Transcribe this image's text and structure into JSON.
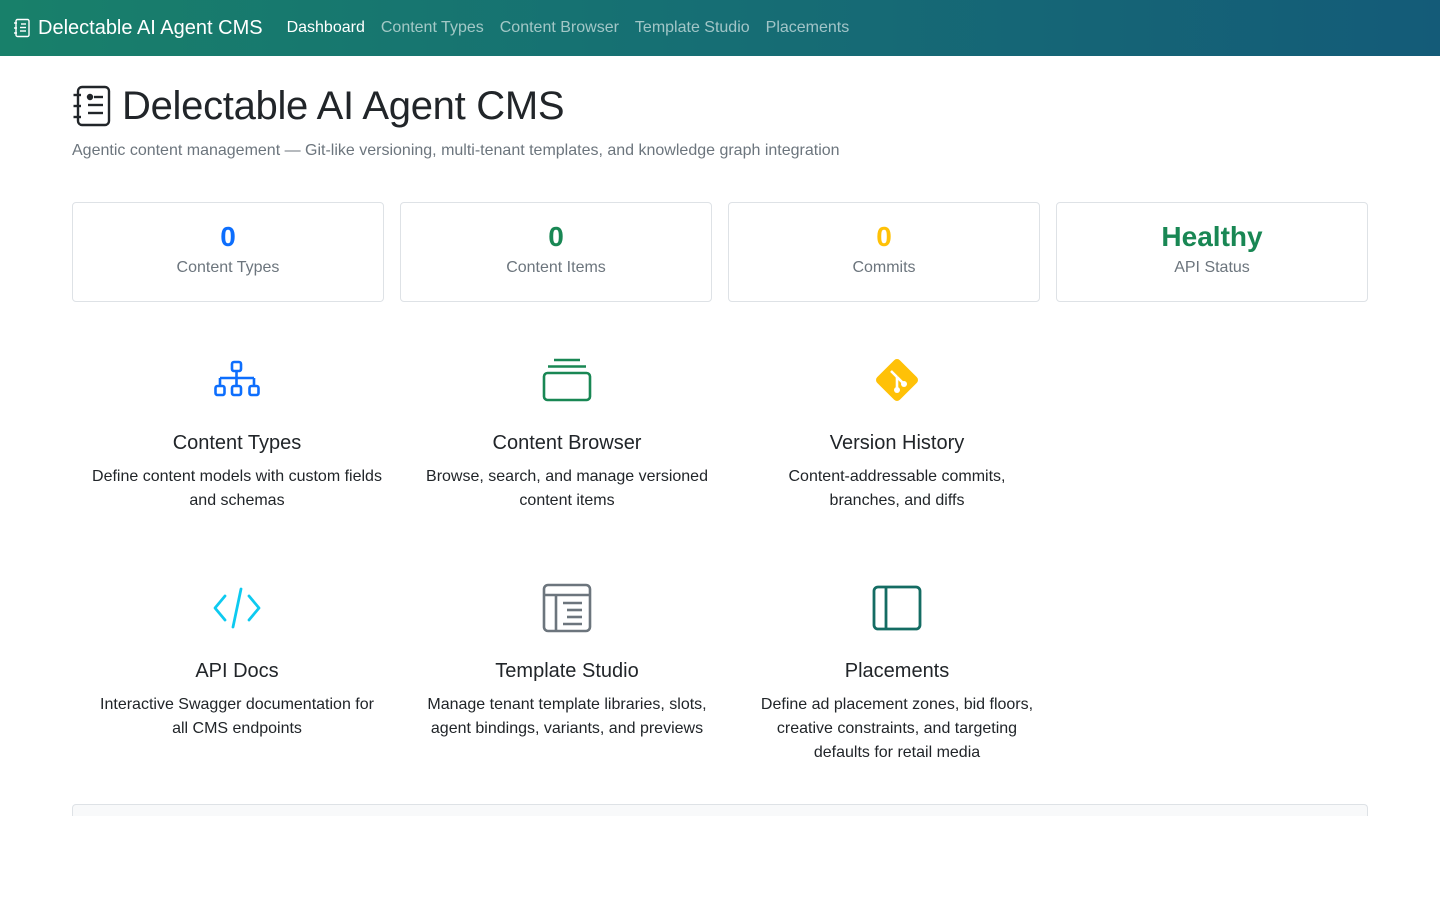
{
  "nav": {
    "brand": "Delectable AI Agent CMS",
    "links": [
      {
        "label": "Dashboard",
        "active": true
      },
      {
        "label": "Content Types",
        "active": false
      },
      {
        "label": "Content Browser",
        "active": false
      },
      {
        "label": "Template Studio",
        "active": false
      },
      {
        "label": "Placements",
        "active": false
      }
    ]
  },
  "header": {
    "title": "Delectable AI Agent CMS",
    "subtitle": "Agentic content management — Git-like versioning, multi-tenant templates, and knowledge graph integration"
  },
  "stats": [
    {
      "value": "0",
      "label": "Content Types",
      "color": "#0d6efd"
    },
    {
      "value": "0",
      "label": "Content Items",
      "color": "#198754"
    },
    {
      "value": "0",
      "label": "Commits",
      "color": "#ffc107"
    },
    {
      "value": "Healthy",
      "label": "API Status",
      "color": "#198754"
    }
  ],
  "features": [
    {
      "title": "Content Types",
      "desc": "Define content models with custom fields and schemas",
      "icon": "diagram-icon",
      "color": "#0d6efd"
    },
    {
      "title": "Content Browser",
      "desc": "Browse, search, and manage versioned content items",
      "icon": "collection-icon",
      "color": "#198754"
    },
    {
      "title": "Version History",
      "desc": "Content-addressable commits, branches, and diffs",
      "icon": "git-icon",
      "color": "#ffc107"
    },
    {
      "title": "API Docs",
      "desc": "Interactive Swagger documentation for all CMS endpoints",
      "icon": "code-icon",
      "color": "#0dcaf0"
    },
    {
      "title": "Template Studio",
      "desc": "Manage tenant template libraries, slots, agent bindings, variants, and previews",
      "icon": "layout-icon",
      "color": "#6c757d"
    },
    {
      "title": "Placements",
      "desc": "Define ad placement zones, bid floors, creative constraints, and targeting defaults for retail media",
      "icon": "sidebar-icon",
      "color": "#146c63"
    }
  ]
}
